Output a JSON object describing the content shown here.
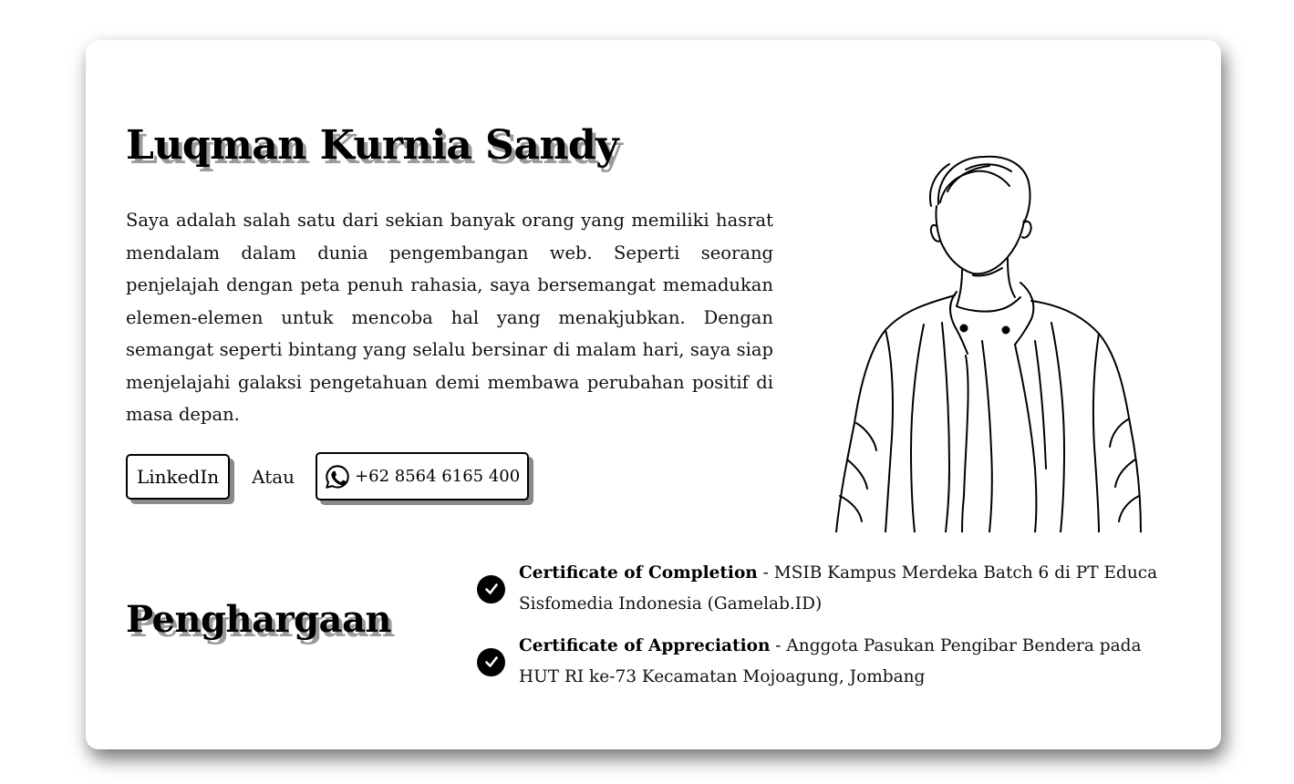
{
  "profile": {
    "name": "Luqman Kurnia Sandy",
    "bio": "Saya adalah salah satu dari sekian banyak orang yang memiliki hasrat mendalam dalam dunia pengembangan web. Seperti seorang penjelajah dengan peta penuh rahasia, saya bersemangat memadukan elemen-elemen untuk mencoba hal yang menakjubkan. Dengan semangat seperti bintang yang selalu bersinar di malam hari, saya siap menjelajahi galaksi pengetahuan demi membawa perubahan positif di masa depan."
  },
  "contact": {
    "linkedin_label": "LinkedIn",
    "or_label": "Atau",
    "whatsapp_icon": "whatsapp-icon",
    "phone": "+62 8564 6165 400"
  },
  "portrait": {
    "icon": "person-line-drawing"
  },
  "awards": {
    "title": "Penghargaan",
    "icon": "check-circle-icon",
    "items": [
      {
        "title": "Certificate of Completion",
        "separator": " - ",
        "description": "MSIB Kampus Merdeka Batch 6 di PT Educa Sisfomedia Indonesia (Gamelab.ID)"
      },
      {
        "title": "Certificate of Appreciation",
        "separator": " - ",
        "description": "Anggota Pasukan Pengibar Bendera pada HUT RI ke-73 Kecamatan Mojoagung, Jombang"
      }
    ]
  },
  "colors": {
    "text": "#111111",
    "shadow": "#9a9a9a",
    "background": "#ffffff"
  }
}
